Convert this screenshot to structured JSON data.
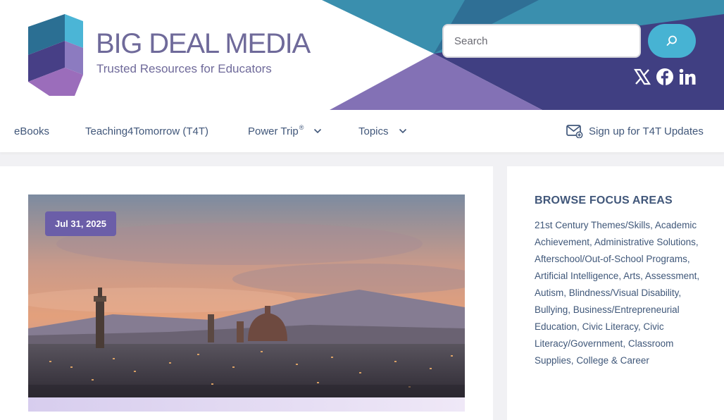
{
  "brand": {
    "title": "BIG DEAL MEDIA",
    "tagline": "Trusted Resources for Educators"
  },
  "search": {
    "placeholder": "Search",
    "value": ""
  },
  "social": [
    "x-icon",
    "facebook-icon",
    "linkedin-icon"
  ],
  "nav": {
    "items": [
      {
        "label": "eBooks"
      },
      {
        "label": "Teaching4Tomorrow (T4T)"
      },
      {
        "label": "Power Trip",
        "sup": "®",
        "dropdown": true
      },
      {
        "label": "Topics",
        "dropdown": true
      }
    ],
    "signup": "Sign up for T4T Updates"
  },
  "post": {
    "date": "Jul 31, 2025"
  },
  "sidebar": {
    "heading": "BROWSE FOCUS AREAS",
    "items": [
      "21st Century Themes/Skills",
      "Academic Achievement",
      "Administrative Solutions",
      "Afterschool/Out-of-School Programs",
      "Artificial Intelligence",
      "Arts",
      "Assessment",
      "Autism",
      "Blindness/Visual Disability",
      "Bullying",
      "Business/Entrepreneurial Education",
      "Civic Literacy",
      "Civic Literacy/Government",
      "Classroom Supplies",
      "College & Career"
    ]
  },
  "colors": {
    "brand_purple": "#6f6a9a",
    "teal": "#3a8fae",
    "nav_text": "#41577a",
    "search_button": "#47b3d3",
    "date_badge": "#6b5ea8"
  }
}
